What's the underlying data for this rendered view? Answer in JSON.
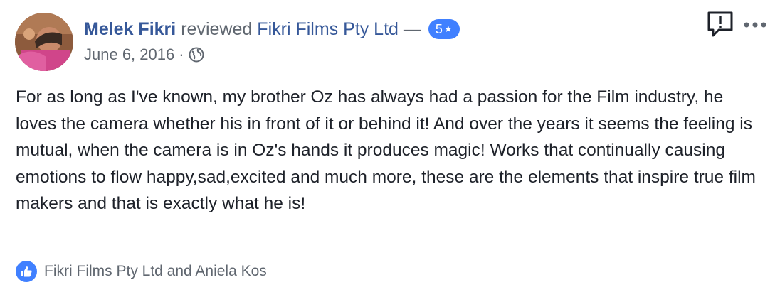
{
  "review": {
    "author": "Melek Fikri",
    "action": "reviewed",
    "page": "Fikri Films Pty Ltd",
    "dash": "—",
    "rating": "5",
    "rating_star": "★",
    "date": "June 6, 2016",
    "separator": "·",
    "privacy_icon": "globe-icon",
    "body": "For as long as I've known, my brother Oz has always had a passion for the Film industry, he loves the camera whether his in front of it or behind it! And over the years it seems the feeling is mutual, when the camera is in Oz's hands it produces magic! Works that continually causing emotions to flow happy,sad,excited and much more, these are the elements that inspire true film makers and that is exactly what he is!",
    "likes_icon": "like-icon",
    "likes": "Fikri Films Pty Ltd and Aniela Kos"
  },
  "actions": {
    "report_icon": "report-icon",
    "more_icon": "more-icon"
  },
  "colors": {
    "link": "#365899",
    "meta": "#606770",
    "badge": "#4080ff",
    "text": "#1d2129"
  }
}
